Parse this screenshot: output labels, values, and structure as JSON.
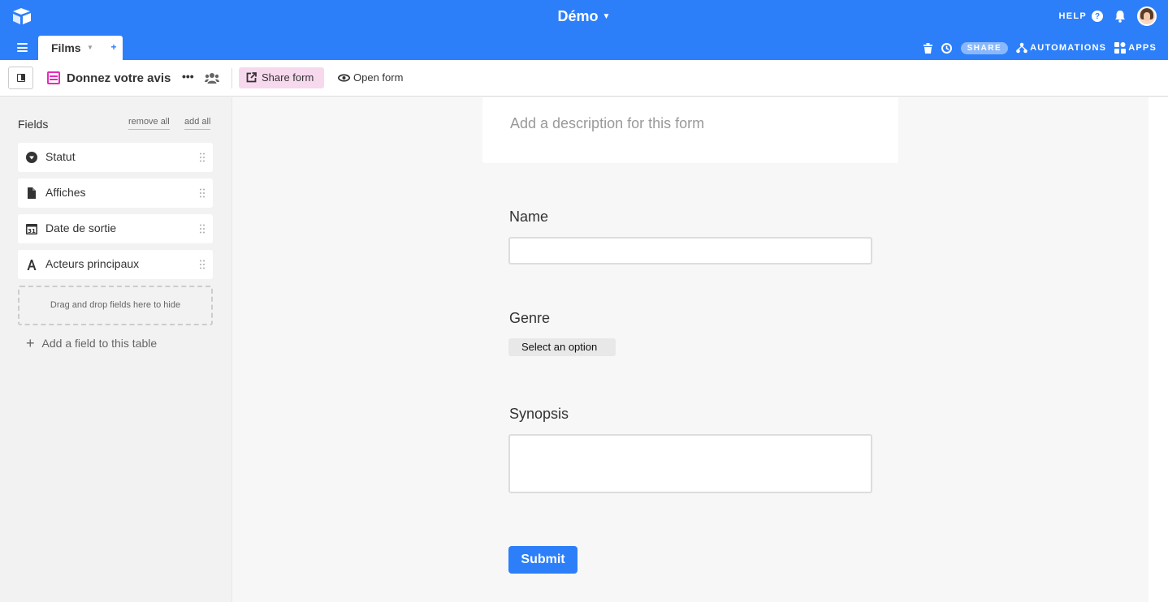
{
  "app": {
    "base_title": "Démo",
    "logo_icon": "airtable-logo-icon",
    "help_label": "HELP",
    "accent_color": "#2d7ff9"
  },
  "tabs": {
    "active_table": "Films",
    "add_table_icon": "add-table-icon"
  },
  "toolbar_right": {
    "share_label": "SHARE",
    "automations_label": "AUTOMATIONS",
    "apps_label": "APPS"
  },
  "view": {
    "name": "Donnez votre avis",
    "more_label": "•••",
    "share_form_label": "Share form",
    "open_form_label": "Open form",
    "form_color": "#e929ba"
  },
  "sidebar": {
    "title": "Fields",
    "remove_all": "remove all",
    "add_all": "add all",
    "hidden_fields": [
      {
        "label": "Statut",
        "icon": "single-select-icon"
      },
      {
        "label": "Affiches",
        "icon": "attachment-icon"
      },
      {
        "label": "Date de sortie",
        "icon": "calendar-icon"
      },
      {
        "label": "Acteurs principaux",
        "icon": "text-icon"
      }
    ],
    "drop_zone": "Drag and drop fields here to hide",
    "add_field": "Add a field to this table"
  },
  "form": {
    "description_placeholder": "Add a description for this form",
    "questions": [
      {
        "label": "Name",
        "type": "text"
      },
      {
        "label": "Genre",
        "type": "select",
        "value": "Select an option"
      },
      {
        "label": "Synopsis",
        "type": "long-text"
      }
    ],
    "submit_label": "Submit"
  }
}
